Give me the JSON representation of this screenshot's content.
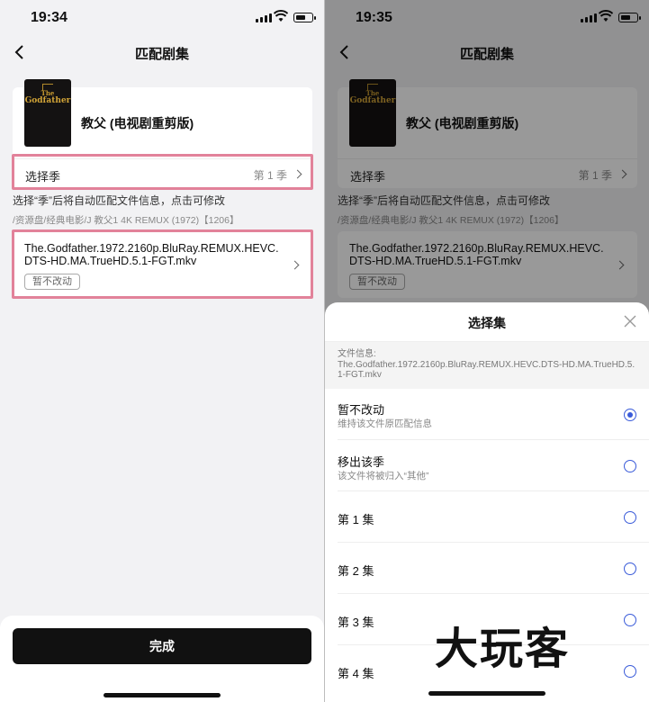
{
  "left": {
    "status": {
      "time": "19:34"
    },
    "nav": {
      "title": "匹配剧集"
    },
    "movie": {
      "poster_title": "The Godfather",
      "poster_line1": "The",
      "poster_line2": "Godfather",
      "title": "教父 (电视剧重剪版)"
    },
    "season": {
      "label": "选择季",
      "value": "第 1 季"
    },
    "hint": "选择“季”后将自动匹配文件信息，点击可修改",
    "path": "/资源盘/经典电影/J 教父1 4K REMUX (1972)【1206】",
    "file": {
      "name": "The.Godfather.1972.2160p.BluRay.REMUX.HEVC.DTS-HD.MA.TrueHD.5.1-FGT.mkv",
      "badge": "暂不改动"
    },
    "done_button": "完成"
  },
  "right": {
    "status": {
      "time": "19:35"
    },
    "nav": {
      "title": "匹配剧集"
    },
    "movie": {
      "title": "教父 (电视剧重剪版)"
    },
    "season": {
      "label": "选择季",
      "value": "第 1 季"
    },
    "hint": "选择“季”后将自动匹配文件信息，点击可修改",
    "path": "/资源盘/经典电影/J 教父1 4K REMUX (1972)【1206】",
    "file": {
      "name": "The.Godfather.1972.2160p.BluRay.REMUX.HEVC.DTS-HD.MA.TrueHD.5.1-FGT.mkv",
      "badge": "暂不改动"
    },
    "sheet": {
      "title": "选择集",
      "file_info_label": "文件信息:",
      "file_info_value": "The.Godfather.1972.2160p.BluRay.REMUX.HEVC.DTS-HD.MA.TrueHD.5.1-FGT.mkv",
      "options": [
        {
          "title": "暂不改动",
          "subtitle": "维持该文件原匹配信息",
          "selected": true
        },
        {
          "title": "移出该季",
          "subtitle": "该文件将被归入“其他”",
          "selected": false
        },
        {
          "title": "第 1 集",
          "subtitle": "",
          "selected": false
        },
        {
          "title": "第 2 集",
          "subtitle": "",
          "selected": false
        },
        {
          "title": "第 3 集",
          "subtitle": "",
          "selected": false
        },
        {
          "title": "第 4 集",
          "subtitle": "",
          "selected": false
        }
      ]
    }
  },
  "watermark": "大玩客",
  "colors": {
    "accent": "#3a5bd9",
    "highlight": "#e2829a",
    "button": "#111111"
  }
}
